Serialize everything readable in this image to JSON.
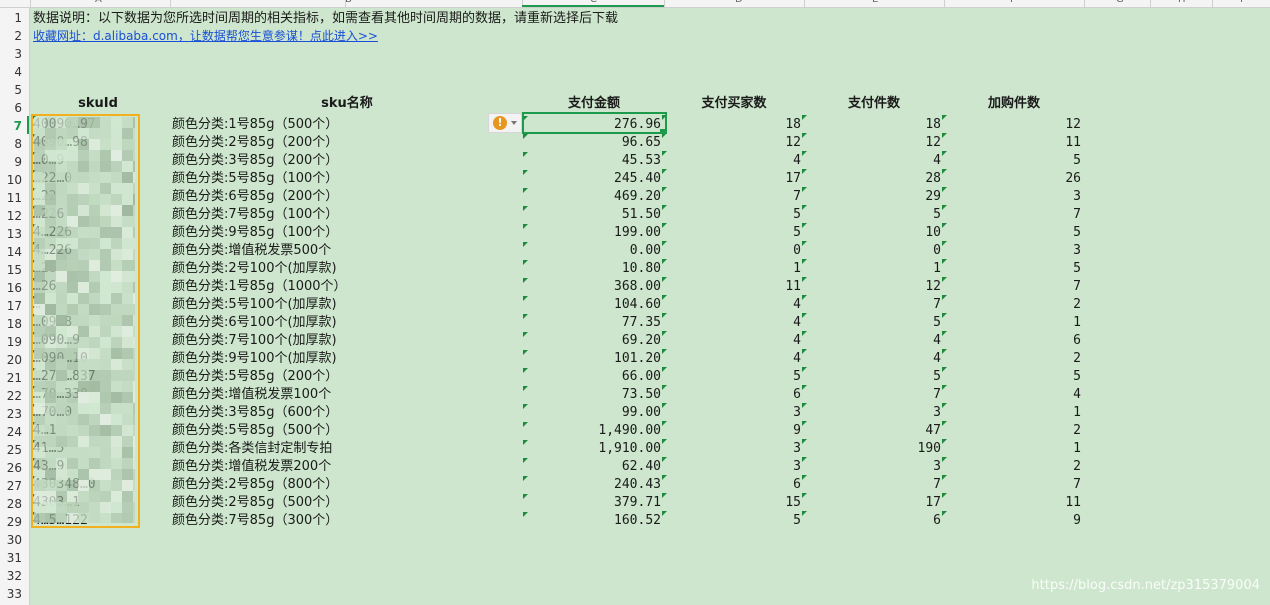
{
  "column_headers": [
    "A",
    "B",
    "C",
    "D",
    "E",
    "F",
    "G",
    "H",
    "I"
  ],
  "row_numbers": [
    "1",
    "2",
    "3",
    "4",
    "5",
    "6",
    "7",
    "8",
    "9",
    "10",
    "11",
    "12",
    "13",
    "14",
    "15",
    "16",
    "17",
    "18",
    "19",
    "20",
    "21",
    "22",
    "23",
    "24",
    "25",
    "26",
    "27",
    "28",
    "29",
    "30",
    "31",
    "32",
    "33"
  ],
  "info_text": "数据说明：以下数据为您所选时间周期的相关指标，如需查看其他时间周期的数据，请重新选择后下载",
  "link_text": "收藏网址：d.alibaba.com，让数据帮您生意参谋！点此进入>>",
  "headers": {
    "sku_id": "skuId",
    "sku_name": "sku名称",
    "pay_amount": "支付金额",
    "buyers": "支付买家数",
    "pieces": "支付件数",
    "cart": "加购件数"
  },
  "rows": [
    {
      "id": "40090…97",
      "name": "颜色分类:1号85g（500个）",
      "amount": "276.96",
      "buyers": "18",
      "pieces": "18",
      "cart": "12"
    },
    {
      "id": "4090…98",
      "name": "颜色分类:2号85g（200个）",
      "amount": "96.65",
      "buyers": "12",
      "pieces": "12",
      "cart": "11"
    },
    {
      "id": "…0…9",
      "name": "颜色分类:3号85g（200个）",
      "amount": "45.53",
      "buyers": "4",
      "pieces": "4",
      "cart": "5"
    },
    {
      "id": "…22…0",
      "name": "颜色分类:5号85g（100个）",
      "amount": "245.40",
      "buyers": "17",
      "pieces": "28",
      "cart": "26"
    },
    {
      "id": "…22",
      "name": "颜色分类:6号85g（200个）",
      "amount": "469.20",
      "buyers": "7",
      "pieces": "29",
      "cart": "3"
    },
    {
      "id": "…226",
      "name": "颜色分类:7号85g（100个）",
      "amount": "51.50",
      "buyers": "5",
      "pieces": "5",
      "cart": "7"
    },
    {
      "id": "4…226",
      "name": "颜色分类:9号85g（100个）",
      "amount": "199.00",
      "buyers": "5",
      "pieces": "10",
      "cart": "5"
    },
    {
      "id": "4…226",
      "name": "颜色分类:增值税发票500个",
      "amount": "0.00",
      "buyers": "0",
      "pieces": "0",
      "cart": "3"
    },
    {
      "id": "…26",
      "name": "颜色分类:2号100个(加厚款)",
      "amount": "10.80",
      "buyers": "1",
      "pieces": "1",
      "cart": "5"
    },
    {
      "id": "…26",
      "name": "颜色分类:1号85g（1000个）",
      "amount": "368.00",
      "buyers": "11",
      "pieces": "12",
      "cart": "7"
    },
    {
      "id": "…",
      "name": "颜色分类:5号100个(加厚款)",
      "amount": "104.60",
      "buyers": "4",
      "pieces": "7",
      "cart": "2"
    },
    {
      "id": "…09…8",
      "name": "颜色分类:6号100个(加厚款)",
      "amount": "77.35",
      "buyers": "4",
      "pieces": "5",
      "cart": "1"
    },
    {
      "id": "…090…9",
      "name": "颜色分类:7号100个(加厚款)",
      "amount": "69.20",
      "buyers": "4",
      "pieces": "4",
      "cart": "6"
    },
    {
      "id": "…090…10",
      "name": "颜色分类:9号100个(加厚款)",
      "amount": "101.20",
      "buyers": "4",
      "pieces": "4",
      "cart": "2"
    },
    {
      "id": "…270…837",
      "name": "颜色分类:5号85g（200个）",
      "amount": "66.00",
      "buyers": "5",
      "pieces": "5",
      "cart": "5"
    },
    {
      "id": "…70…338",
      "name": "颜色分类:增值税发票100个",
      "amount": "73.50",
      "buyers": "6",
      "pieces": "7",
      "cart": "4"
    },
    {
      "id": "…70…0",
      "name": "颜色分类:3号85g（600个）",
      "amount": "99.00",
      "buyers": "3",
      "pieces": "3",
      "cart": "1"
    },
    {
      "id": "4…1",
      "name": "颜色分类:5号85g（500个）",
      "amount": "1,490.00",
      "buyers": "9",
      "pieces": "47",
      "cart": "2"
    },
    {
      "id": "41…5",
      "name": "颜色分类:各类信封定制专拍",
      "amount": "1,910.00",
      "buyers": "3",
      "pieces": "190",
      "cart": "1"
    },
    {
      "id": "43…9",
      "name": "颜色分类:增值税发票200个",
      "amount": "62.40",
      "buyers": "3",
      "pieces": "3",
      "cart": "2"
    },
    {
      "id": "430348…0",
      "name": "颜色分类:2号85g（800个）",
      "amount": "240.43",
      "buyers": "6",
      "pieces": "7",
      "cart": "7"
    },
    {
      "id": "4303…1",
      "name": "颜色分类:2号85g（500个）",
      "amount": "379.71",
      "buyers": "15",
      "pieces": "17",
      "cart": "11"
    },
    {
      "id": "4…5…122",
      "name": "颜色分类:7号85g（300个）",
      "amount": "160.52",
      "buyers": "5",
      "pieces": "6",
      "cart": "9"
    }
  ],
  "warning_icon": "exclamation-circle-icon",
  "watermark": "https://blog.csdn.net/zp315379004",
  "colors": {
    "sheet_bg": "#cde6cd",
    "selection": "#1e9a4d",
    "highlight": "#f2b01e",
    "warning": "#e8961d",
    "link": "#1a4fd6"
  }
}
